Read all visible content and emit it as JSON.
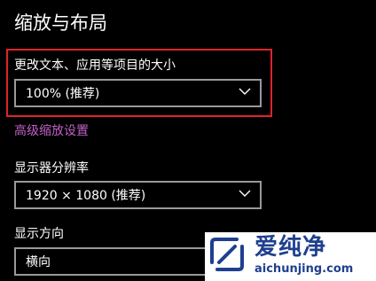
{
  "section": {
    "title": "缩放与布局"
  },
  "scale": {
    "label": "更改文本、应用等项目的大小",
    "value": "100% (推荐)",
    "dropdown_icon": "chevron-down-icon",
    "highlight_color": "#e0232b"
  },
  "advanced_link": {
    "label": "高级缩放设置",
    "color": "#c160c9"
  },
  "resolution": {
    "label": "显示器分辨率",
    "value": "1920 × 1080 (推荐)",
    "dropdown_icon": "chevron-down-icon"
  },
  "orientation": {
    "label": "显示方向",
    "value": "横向",
    "dropdown_icon": "chevron-down-icon"
  },
  "watermark": {
    "name": "爱纯净",
    "url": "aichunjing.com",
    "icon": "logo-icon"
  }
}
